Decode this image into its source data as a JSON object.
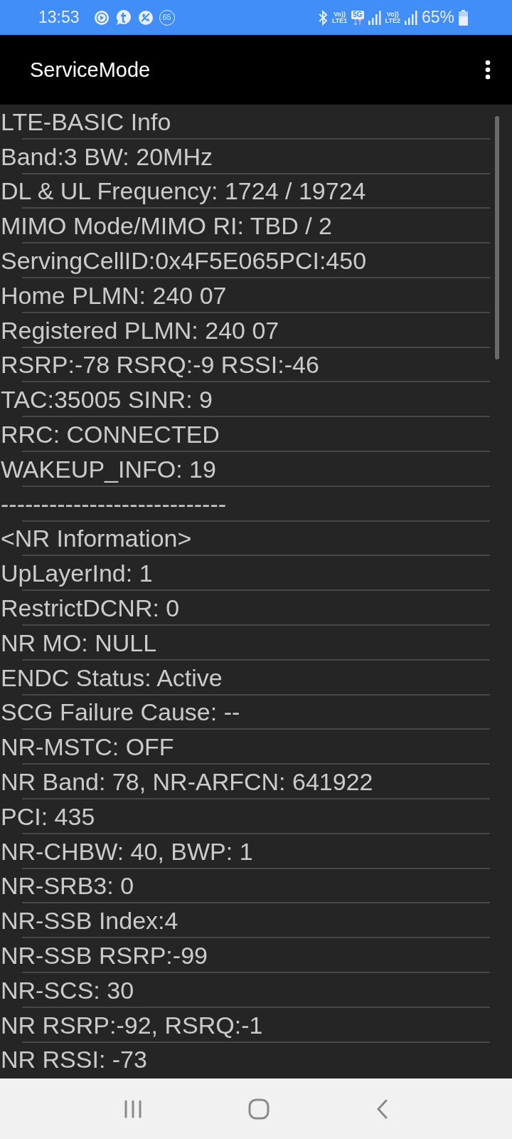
{
  "status_bar": {
    "time": "13:53",
    "notifications": [
      {
        "kind": "play"
      },
      {
        "kind": "chat"
      },
      {
        "kind": "call-off"
      },
      {
        "kind": "number",
        "text": "65"
      }
    ],
    "indicators": [
      {
        "kind": "bluetooth"
      },
      {
        "kind": "volte",
        "top": "Vo))",
        "bottom": "LTE1"
      },
      {
        "kind": "network",
        "text": "5G"
      },
      {
        "kind": "signal"
      },
      {
        "kind": "volte",
        "top": "Vo))",
        "bottom": "LTE2"
      },
      {
        "kind": "signal"
      }
    ],
    "battery": "65%"
  },
  "app_bar": {
    "title": "ServiceMode"
  },
  "rows": [
    "LTE-BASIC Info",
    "Band:3 BW: 20MHz",
    "DL & UL Frequency: 1724 / 19724",
    "MIMO Mode/MIMO RI: TBD / 2",
    "ServingCellID:0x4F5E065PCI:450",
    "Home PLMN: 240 07",
    "Registered PLMN: 240 07",
    "RSRP:-78 RSRQ:-9 RSSI:-46",
    "TAC:35005 SINR: 9",
    "RRC: CONNECTED",
    "WAKEUP_INFO: 19",
    "----------------------------",
    "<NR Information>",
    "UpLayerInd: 1",
    "RestrictDCNR: 0",
    "NR MO: NULL",
    "ENDC Status: Active",
    "SCG Failure Cause: --",
    "NR-MSTC: OFF",
    "NR Band: 78, NR-ARFCN: 641922",
    "PCI: 435",
    "NR-CHBW: 40, BWP: 1",
    "NR-SRB3: 0",
    "NR-SSB Index:4",
    "NR-SSB RSRP:-99",
    "NR-SCS: 30",
    "NR RSRP:-92, RSRQ:-1",
    "NR RSSI: -73"
  ]
}
